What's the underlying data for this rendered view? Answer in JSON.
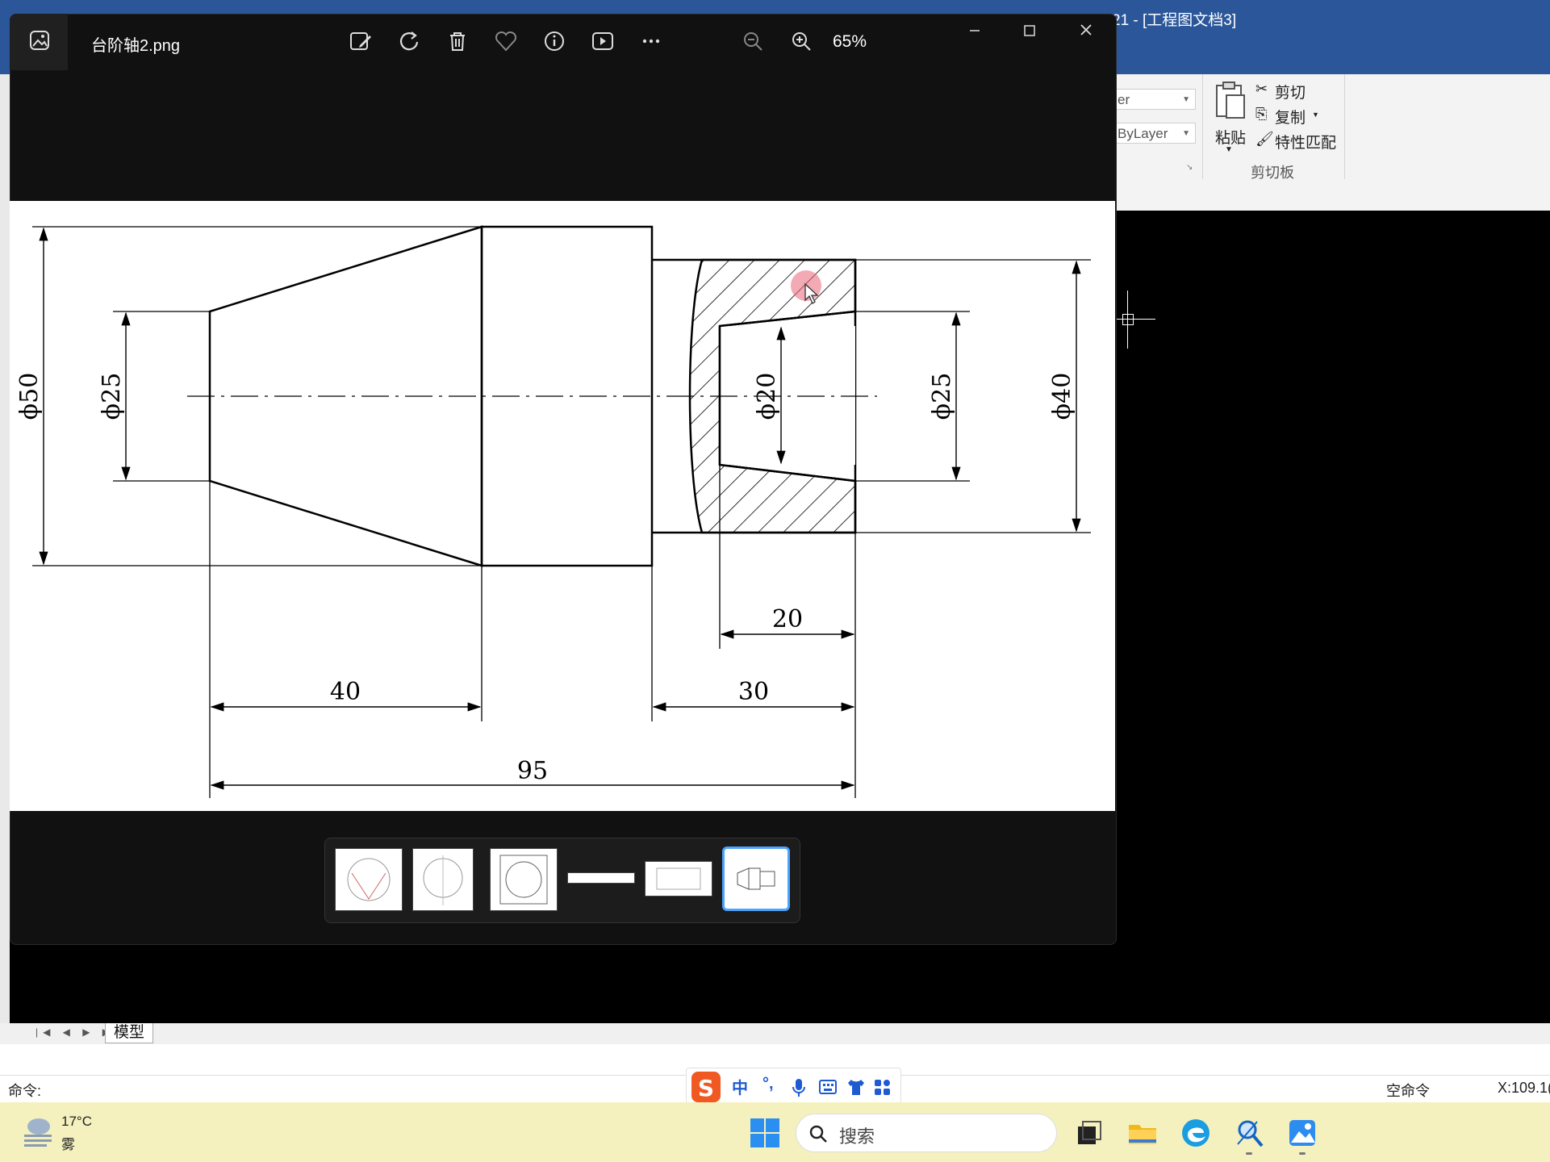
{
  "cad_app": {
    "title": "21 - [工程图文档3]",
    "ribbon": {
      "layer_field": "er",
      "linetype_field": "ByLayer",
      "paste_label": "粘贴",
      "cut_label": "剪切",
      "copy_label": "复制",
      "match_props_label": "特性匹配",
      "clipboard_group": "剪切板"
    },
    "layout_tab": "模型",
    "command_label": "命令:",
    "status_text": "空命令",
    "coords_text": "X:109.1("
  },
  "ime": {
    "items": [
      "中",
      "°,"
    ]
  },
  "taskbar": {
    "weather_temp": "17°C",
    "weather_condition": "雾",
    "search_placeholder": "搜索"
  },
  "viewer": {
    "filename": "台阶轴2.png",
    "zoom": "65%",
    "toolbar_icons": [
      "edit-image-icon",
      "rotate-icon",
      "delete-icon",
      "favorite-icon",
      "info-icon",
      "slideshow-icon",
      "more-icon",
      "zoom-out-icon",
      "zoom-in-icon"
    ],
    "thumbnail_count": 6,
    "selected_thumbnail": 6
  },
  "drawing": {
    "dimensions": {
      "d50": "ϕ50",
      "d25_left": "ϕ25",
      "d20": "ϕ20",
      "d25_right": "ϕ25",
      "d40": "ϕ40",
      "len20": "20",
      "len40": "40",
      "len30": "30",
      "len95": "95"
    }
  },
  "colors": {
    "cad_title_bar": "#2b579a",
    "taskbar": "#f4f1bf",
    "viewer_bg": "#111111",
    "accent": "#4aa3ff"
  }
}
